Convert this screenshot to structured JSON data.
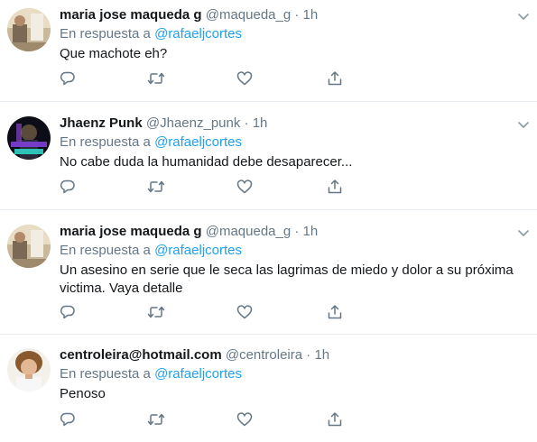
{
  "tweets": [
    {
      "name": "maria jose maqueda g",
      "handle": "@maqueda_g",
      "separator": "·",
      "time": "1h",
      "reply_prefix": "En respuesta a",
      "reply_to": "@rafaeljcortes",
      "text": "Que machote eh?",
      "avatar_icon": "avatar-photo-room"
    },
    {
      "name": "Jhaenz Punk",
      "handle": "@Jhaenz_punk",
      "separator": "·",
      "time": "1h",
      "reply_prefix": "En respuesta a",
      "reply_to": "@rafaeljcortes",
      "text": "No cabe duda la humanidad debe desaparecer...",
      "avatar_icon": "avatar-punk-neon"
    },
    {
      "name": "maria jose maqueda g",
      "handle": "@maqueda_g",
      "separator": "·",
      "time": "1h",
      "reply_prefix": "En respuesta a",
      "reply_to": "@rafaeljcortes",
      "text": "Un asesino en serie que le seca las lagrimas de miedo y dolor a su próxima victima. Vaya detalle",
      "avatar_icon": "avatar-photo-room"
    },
    {
      "name": "centroleira@hotmail.com",
      "handle": "@centroleira",
      "separator": "·",
      "time": "1h",
      "reply_prefix": "En respuesta a",
      "reply_to": "@rafaeljcortes",
      "text": "Penoso",
      "avatar_icon": "avatar-photo-person"
    }
  ],
  "icons": {
    "reply": "reply-icon",
    "retweet": "retweet-icon",
    "like": "heart-icon",
    "share": "share-icon",
    "more": "chevron-down-icon"
  },
  "colors": {
    "accent": "#1da1f2",
    "muted": "#657786",
    "text": "#14171a",
    "divider": "#e6ecf0"
  }
}
